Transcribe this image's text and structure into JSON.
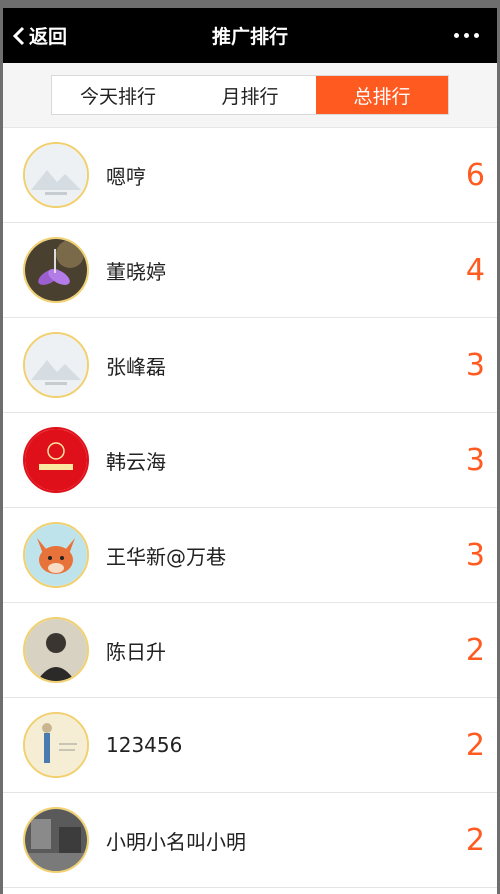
{
  "nav": {
    "back_label": "返回",
    "title": "推广排行",
    "more_icon": "ellipsis-icon"
  },
  "tabs": [
    {
      "label": "今天排行",
      "active": false
    },
    {
      "label": "月排行",
      "active": false
    },
    {
      "label": "总排行",
      "active": true
    }
  ],
  "colors": {
    "accent": "#ff5a1f",
    "avatar_border": "#f1d070",
    "navbar": "#000000"
  },
  "rankings": [
    {
      "name": "嗯哼",
      "score": "6",
      "avatar": "placeholder-landscape"
    },
    {
      "name": "董晓婷",
      "score": "4",
      "avatar": "photo-purple-flower"
    },
    {
      "name": "张峰磊",
      "score": "3",
      "avatar": "placeholder-landscape"
    },
    {
      "name": "韩云海",
      "score": "3",
      "avatar": "red-logo"
    },
    {
      "name": "王华新@万巷",
      "score": "3",
      "avatar": "cartoon-fox"
    },
    {
      "name": "陈日升",
      "score": "2",
      "avatar": "photo-man"
    },
    {
      "name": "123456",
      "score": "2",
      "avatar": "cartoon-figure"
    },
    {
      "name": "小明小名叫小明",
      "score": "2",
      "avatar": "photo-street"
    }
  ]
}
